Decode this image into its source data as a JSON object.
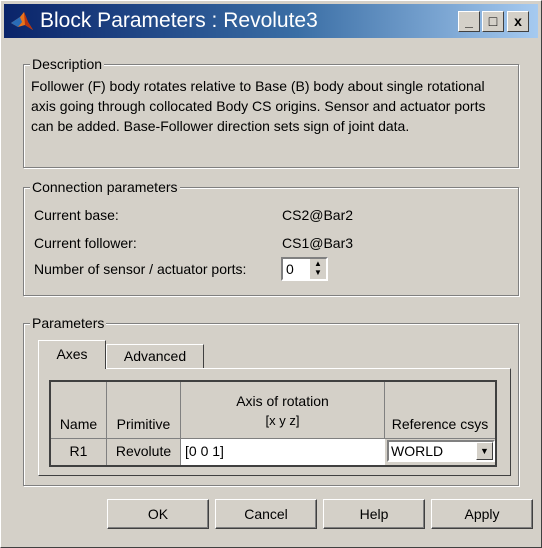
{
  "window": {
    "title": "Block Parameters : Revolute3",
    "controls": {
      "minimize": "_",
      "maximize": "□",
      "close": "x"
    }
  },
  "description": {
    "legend": "Description",
    "text": "Follower (F) body rotates relative to Base (B) body about single rotational axis going through collocated Body CS origins. Sensor and actuator ports can be added. Base-Follower direction sets sign of joint data."
  },
  "connection": {
    "legend": "Connection parameters",
    "current_base_label": "Current base:",
    "current_base_value": "CS2@Bar2",
    "current_follower_label": "Current follower:",
    "current_follower_value": "CS1@Bar3",
    "ports_label": "Number of sensor / actuator ports:",
    "ports_value": "0"
  },
  "parameters": {
    "legend": "Parameters",
    "tabs": [
      "Axes",
      "Advanced"
    ],
    "active_tab": "Axes",
    "table": {
      "headers": [
        "Name",
        "Primitive",
        "Axis of rotation",
        "[x y z]",
        "Reference csys"
      ],
      "rows": [
        {
          "name": "R1",
          "primitive": "Revolute",
          "axis": "[0 0 1]",
          "csys": "WORLD"
        }
      ]
    }
  },
  "buttons": {
    "ok": "OK",
    "cancel": "Cancel",
    "help": "Help",
    "apply": "Apply"
  }
}
